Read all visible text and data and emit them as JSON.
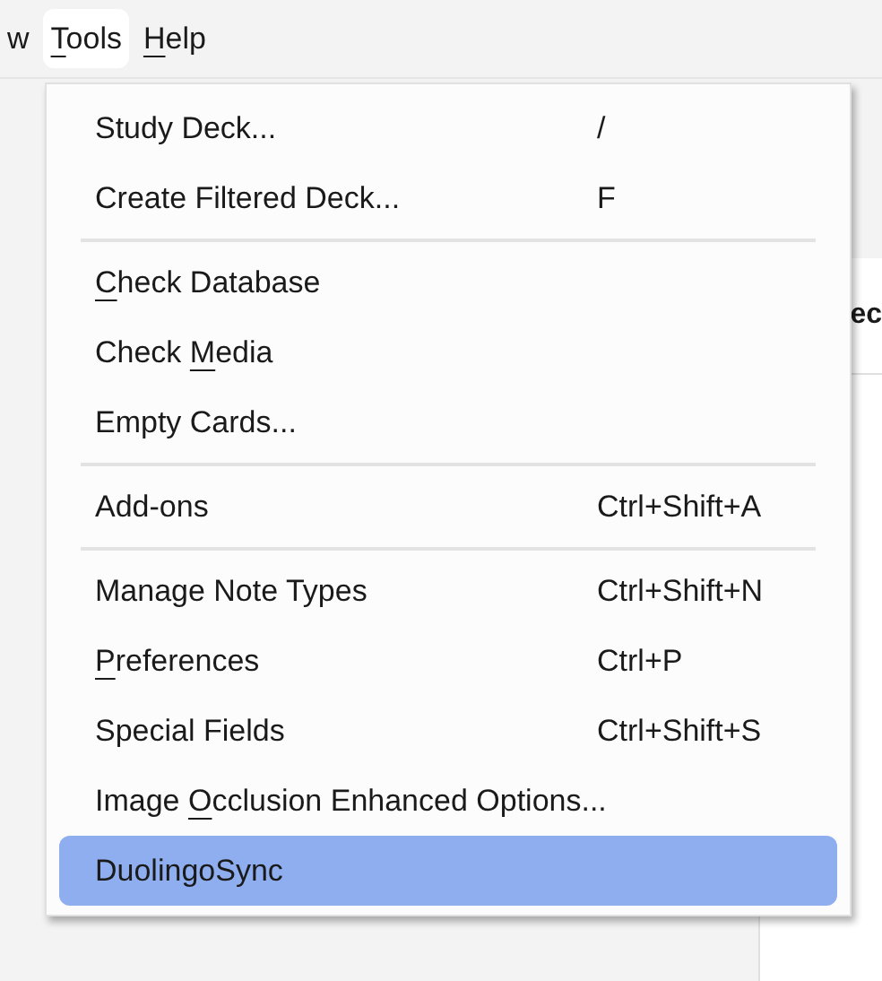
{
  "menubar": [
    {
      "pre": "w",
      "selected": false
    },
    {
      "key": "T",
      "post": "ools",
      "selected": true
    },
    {
      "key": "H",
      "post": "elp",
      "selected": false
    }
  ],
  "background": {
    "heading": "ec"
  },
  "menu": {
    "groups": [
      [
        {
          "pre": "Study Deck...",
          "shortcut": "/",
          "selected": false
        },
        {
          "pre": "Create Filtered Deck...",
          "shortcut": "F",
          "selected": false
        }
      ],
      [
        {
          "key": "C",
          "post": "heck Database",
          "selected": false
        },
        {
          "pre": "Check ",
          "key": "M",
          "post": "edia",
          "selected": false
        },
        {
          "pre": "Empty Cards...",
          "selected": false
        }
      ],
      [
        {
          "pre": "Add-ons",
          "shortcut": "Ctrl+Shift+A",
          "selected": false
        }
      ],
      [
        {
          "pre": "Manage Note Types",
          "shortcut": "Ctrl+Shift+N",
          "selected": false
        },
        {
          "key": "P",
          "post": "references",
          "shortcut": "Ctrl+P",
          "selected": false
        },
        {
          "pre": "Special Fields",
          "shortcut": "Ctrl+Shift+S",
          "selected": false
        },
        {
          "pre": "Image ",
          "key": "O",
          "post": "cclusion Enhanced Options...",
          "selected": false
        },
        {
          "pre": "DuolingoSync",
          "selected": true
        }
      ]
    ]
  }
}
